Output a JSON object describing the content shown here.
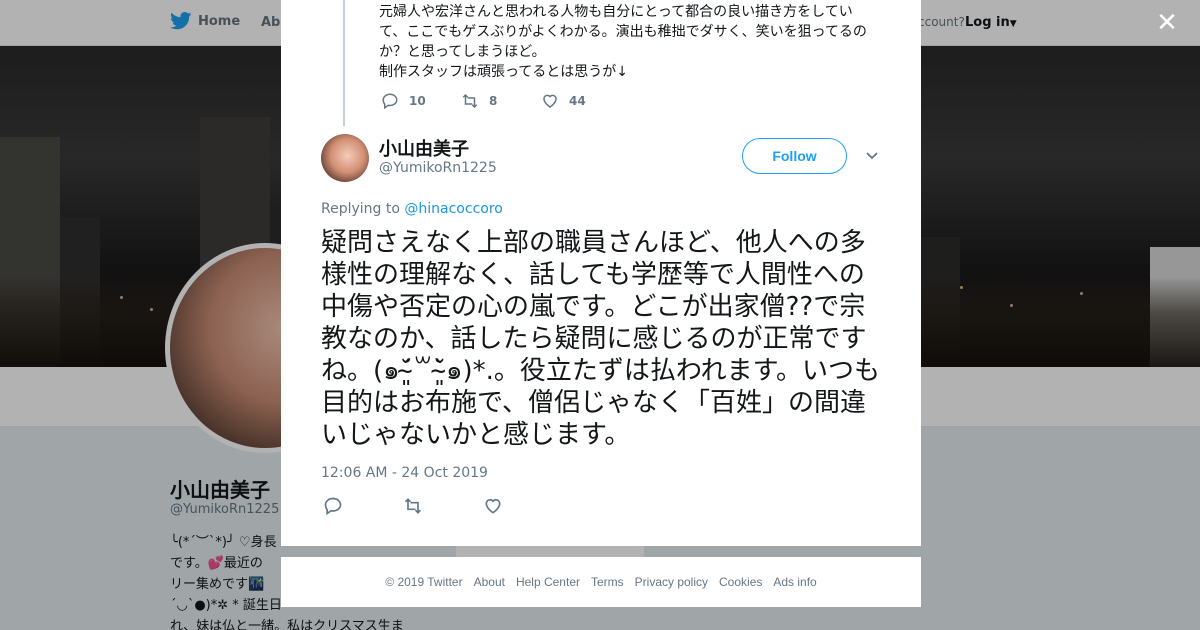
{
  "nav": {
    "home_label": "Home",
    "about_label": "Abo",
    "account_text": "ccount?",
    "login_label": "Log in"
  },
  "profile": {
    "name": "小山由美子",
    "handle": "@YumikoRn1225",
    "bio_lines": [
      "╰(*´︶`*)╯ ♡身長",
      "です。💕最近の",
      "リー集めです🌃",
      "´◡`●)*✲ * 誕生日",
      "れ、妹は仏と一緒。私はクリスマス生ま"
    ]
  },
  "parent_tweet": {
    "text_lines": [
      "元婦人や宏洋さんと思われる人物も自分にとって都合の良い描き方をしてい",
      "て、ここでもゲスぶりがよくわかる。演出も稚拙でダサく、笑いを狙ってるの",
      "か？と思ってしまうほど。",
      "制作スタッフは頑張ってるとは思うが↓"
    ],
    "reply_count": "10",
    "retweet_count": "8",
    "like_count": "44"
  },
  "tweet": {
    "author_name": "小山由美子",
    "author_handle": "@YumikoRn1225",
    "follow_label": "Follow",
    "replying_prefix": "Replying to",
    "replying_to": "@hinacoccoro",
    "text": "疑問さえなく上部の職員さんほど、他人への多様性の理解なく、話しても学歴等で人間性への中傷や否定の心の嵐です。どこが出家僧??で宗教なのか、話したら疑問に感じるのが正常ですね。(๑˘̴͈́꒳˘̴͈̀๑)*.。役立たずは払われます。いつも目的はお布施で、僧侶じゃなく「百姓」の間違いじゃないかと感じます。",
    "timestamp": "12:06 AM - 24 Oct 2019"
  },
  "footer": {
    "links": [
      "© 2019 Twitter",
      "About",
      "Help Center",
      "Terms",
      "Privacy policy",
      "Cookies",
      "Ads info"
    ]
  },
  "colors": {
    "accent": "#1da1f2",
    "link": "#1b95e0",
    "muted": "#657786",
    "text": "#14171a"
  },
  "icons": [
    "twitter-bird-icon",
    "close-icon",
    "reply-icon",
    "retweet-icon",
    "like-icon",
    "chevron-down-icon"
  ]
}
